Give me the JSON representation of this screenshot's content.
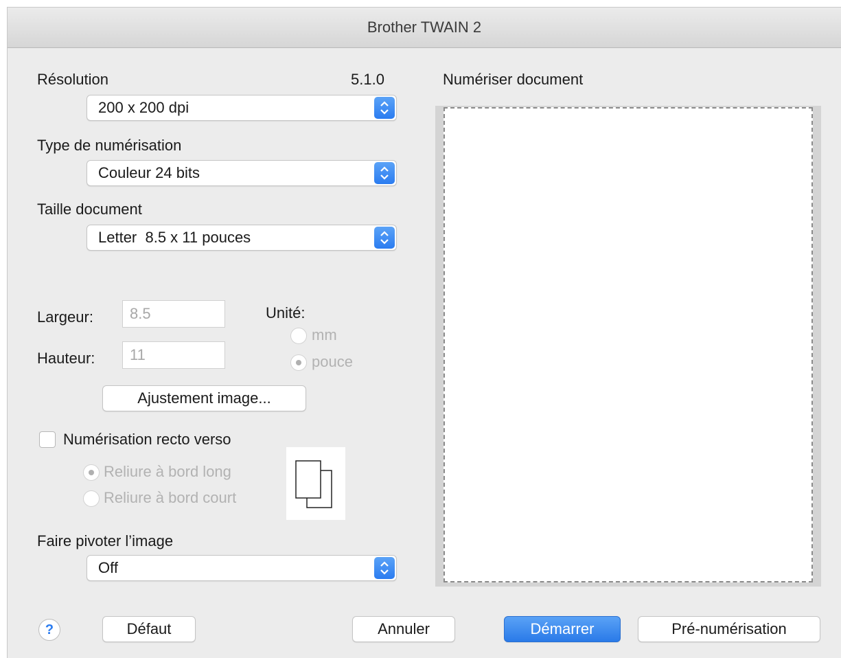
{
  "window": {
    "title": "Brother TWAIN 2",
    "version": "5.1.0"
  },
  "resolution": {
    "label": "Résolution",
    "value": "200 x 200 dpi"
  },
  "scan_type": {
    "label": "Type de numérisation",
    "value": "Couleur 24 bits"
  },
  "doc_size": {
    "label": "Taille document",
    "value": "Letter  8.5 x 11 pouces"
  },
  "width": {
    "label": "Largeur:",
    "value": "8.5"
  },
  "height": {
    "label": "Hauteur:",
    "value": "11"
  },
  "unit": {
    "label": "Unité:",
    "options": [
      "mm",
      "pouce"
    ],
    "selected": "pouce"
  },
  "adjust_button": "Ajustement image...",
  "duplex": {
    "label": "Numérisation recto verso",
    "checked": false,
    "options": [
      "Reliure à bord long",
      "Reliure à bord court"
    ],
    "selected": "Reliure à bord long"
  },
  "rotate": {
    "label": "Faire pivoter l’image",
    "value": "Off"
  },
  "preview": {
    "label": "Numériser document"
  },
  "footer": {
    "help": "?",
    "default_button": "Défaut",
    "cancel_button": "Annuler",
    "start_button": "Démarrer",
    "prescan_button": "Pré-numérisation"
  },
  "colors": {
    "accent": "#2b7cf0",
    "window_bg": "#ececec"
  }
}
